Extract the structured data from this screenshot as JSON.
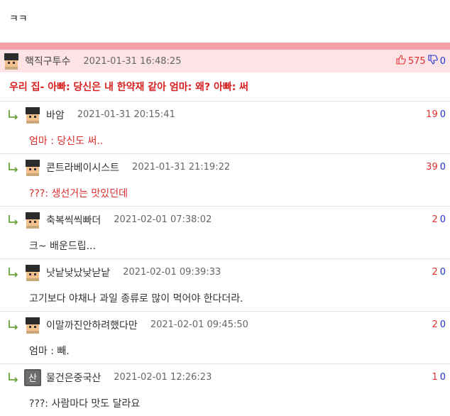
{
  "post": {
    "text": "ㅋㅋ"
  },
  "best": {
    "nick": "핵직구투수",
    "date": "2021-01-31 16:48:25",
    "up": "575",
    "down": "0",
    "body": "우리 집- 아빠: 당신은 내 한약재 같아 엄마: 왜? 아빠: 써",
    "accent": "#f5a0a6"
  },
  "replies": [
    {
      "nick": "바암",
      "date": "2021-01-31 20:15:41",
      "up": "19",
      "down": "0",
      "body": "엄마 : 당신도 써.."
    },
    {
      "nick": "콘트라베이시스트",
      "date": "2021-01-31 21:19:22",
      "up": "39",
      "down": "0",
      "body": "???: 생선거는 맛있던데"
    },
    {
      "nick": "축복씩씩빠더",
      "date": "2021-02-01 07:38:02",
      "up": "2",
      "down": "0",
      "body": "크~ 배운드립..."
    },
    {
      "nick": "낫낱낮났낮낟낱",
      "date": "2021-02-01 09:39:33",
      "up": "2",
      "down": "0",
      "body": "고기보다 야채나 과일 종류로 많이 먹어야 한다더라."
    },
    {
      "nick": "이말까진안하려했다만",
      "date": "2021-02-01 09:45:50",
      "up": "2",
      "down": "0",
      "body": "엄마 : 빼."
    },
    {
      "nick": "물건은중국산",
      "date": "2021-02-01 12:26:23",
      "up": "1",
      "down": "0",
      "body": "???: 사람마다 맛도 달라요",
      "avatar_text": "산"
    }
  ]
}
